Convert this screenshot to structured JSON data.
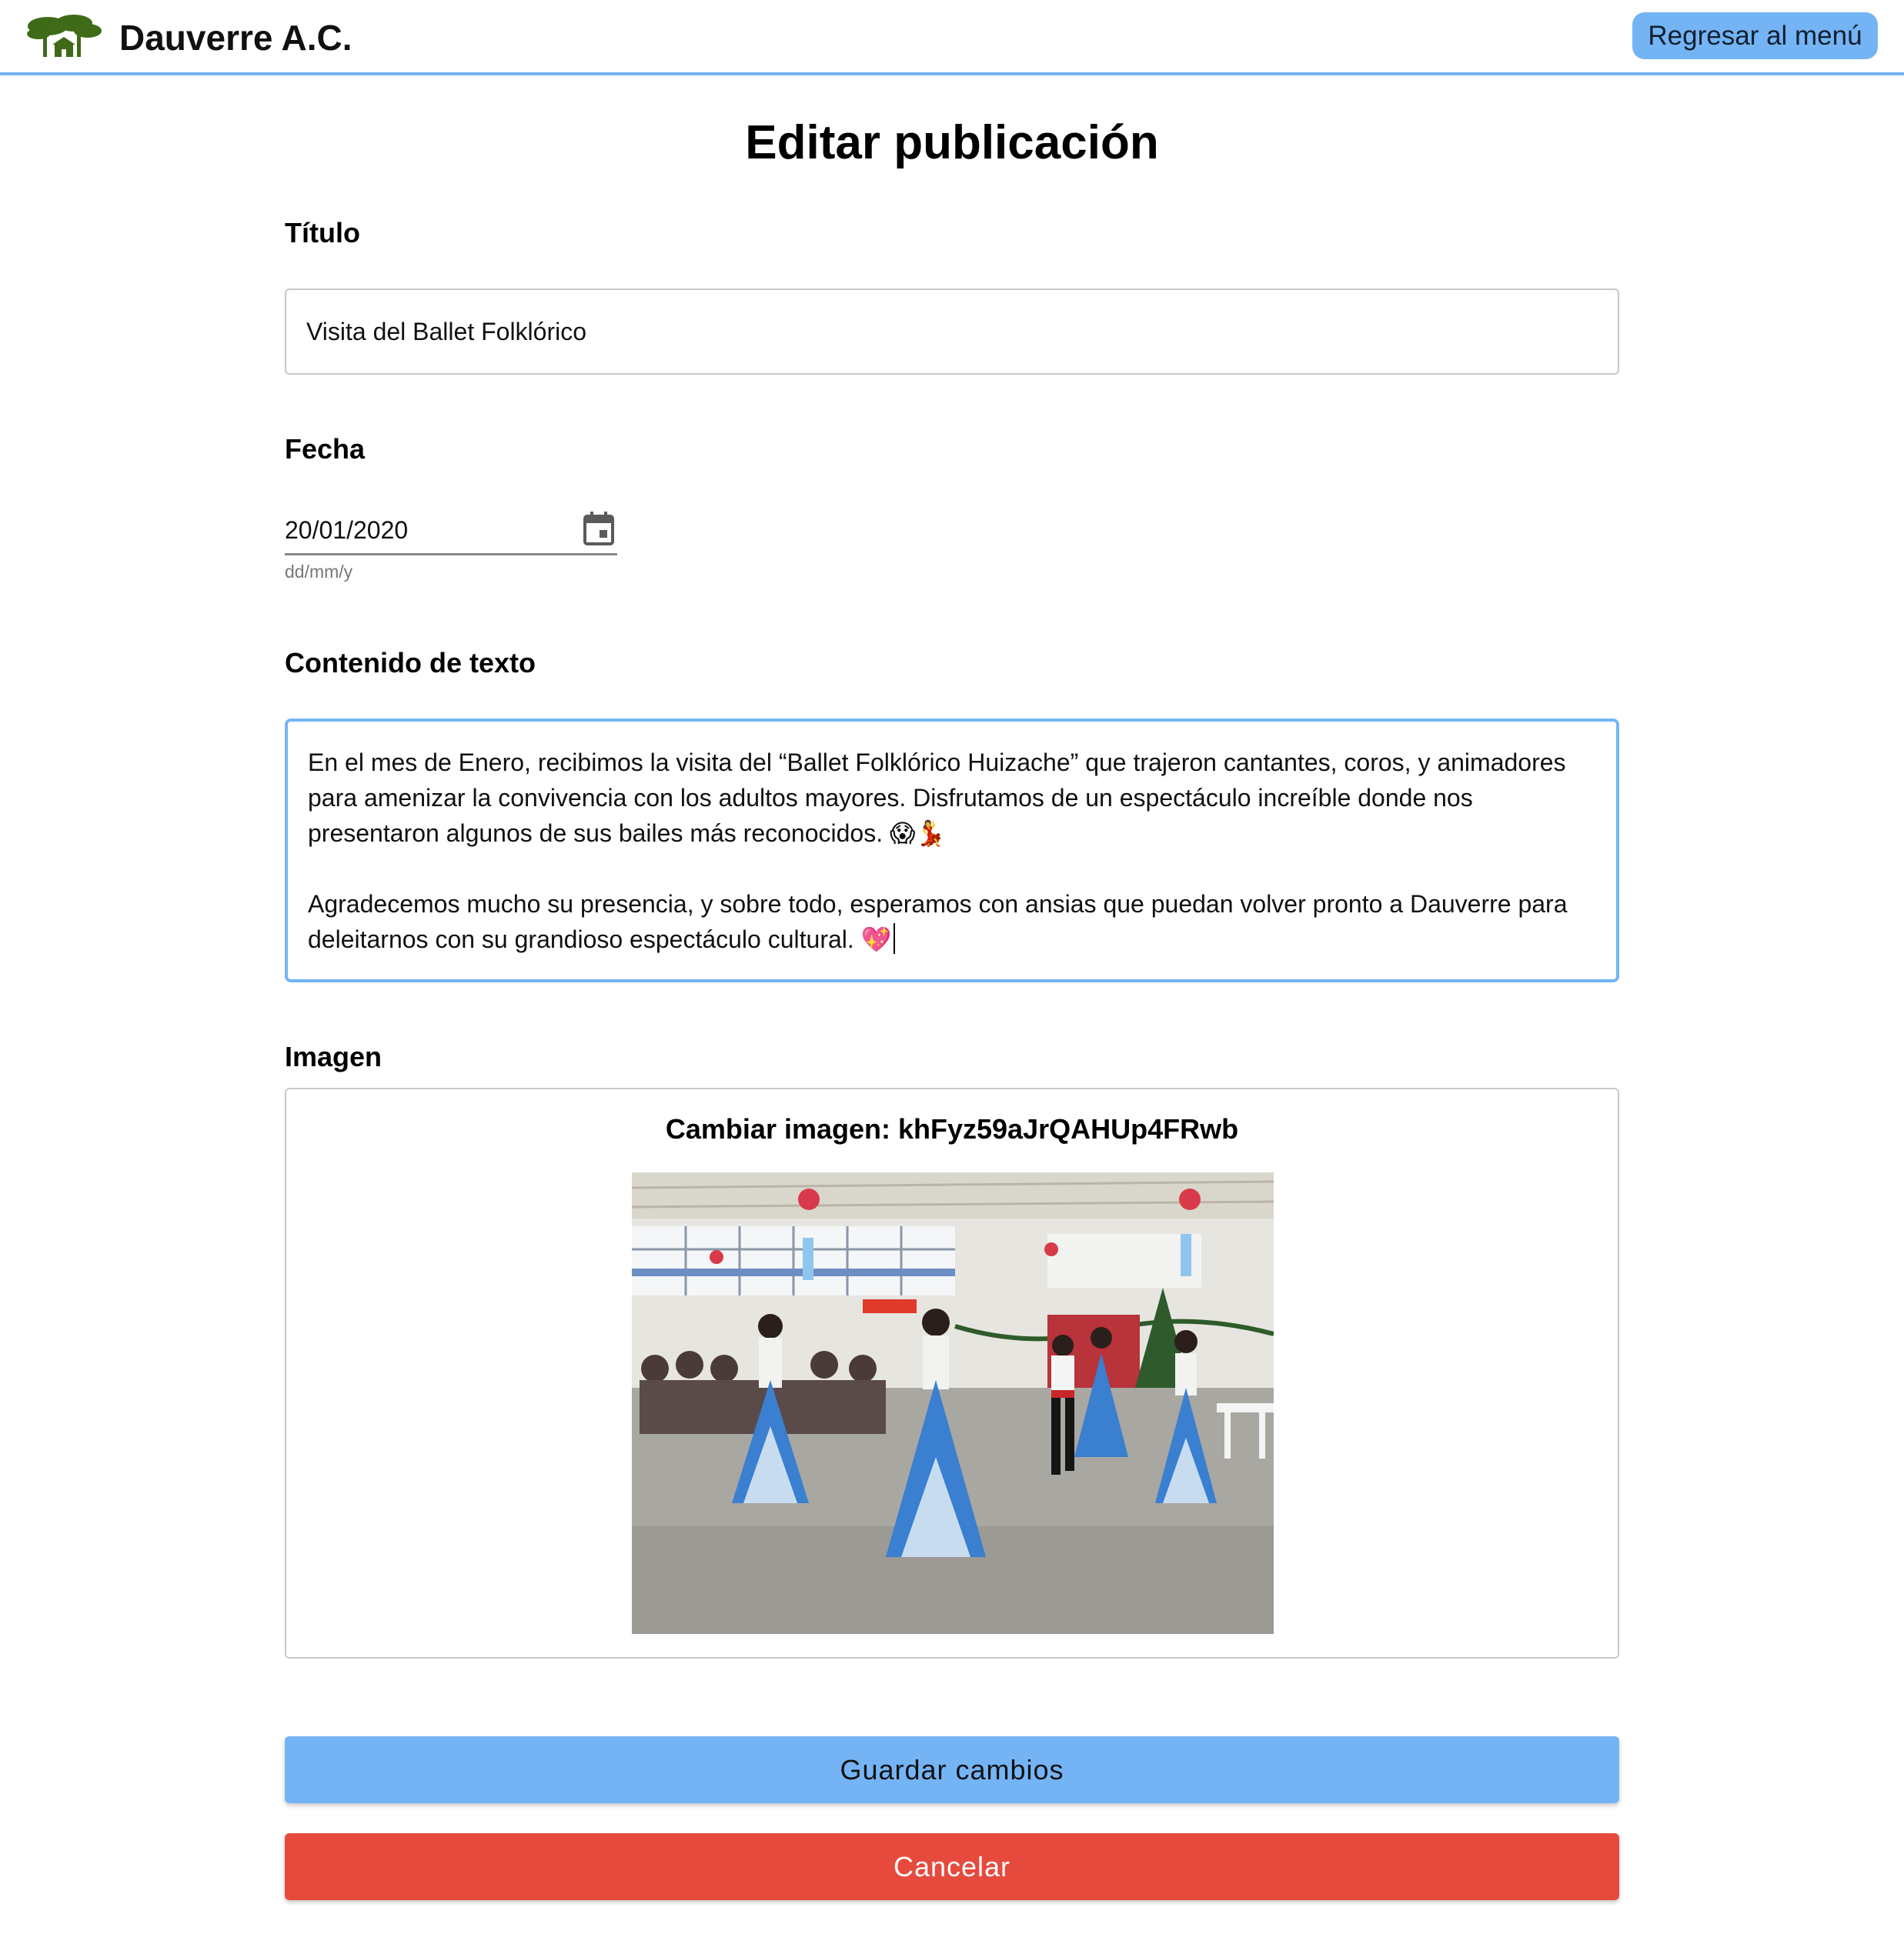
{
  "header": {
    "brand": "Dauverre A.C.",
    "logo_icon": "tree-logo-icon",
    "back_button_label": "Regresar al menú"
  },
  "page": {
    "title": "Editar publicación"
  },
  "form": {
    "title_label": "Título",
    "title_value": "Visita del Ballet Folklórico",
    "date_label": "Fecha",
    "date_value": "20/01/2020",
    "date_hint": "dd/mm/y",
    "date_icon": "calendar-icon",
    "content_label": "Contenido de texto",
    "content_paragraph_1": "En el mes de Enero, recibimos la visita del “Ballet Folklórico Huizache” que trajeron cantantes, coros, y animadores para amenizar la convivencia con los adultos mayores. Disfrutamos de un espectáculo increíble donde nos presentaron algunos de sus bailes más reconocidos. 😱💃",
    "content_paragraph_2": "Agradecemos mucho su presencia, y sobre todo, esperamos con ansias que puedan volver pronto a Dauverre para deleitarnos con su grandioso espectáculo cultural. 💖",
    "image_label": "Imagen",
    "image_caption": "Cambiar imagen: khFyz59aJrQAHUp4FRwb"
  },
  "actions": {
    "save_label": "Guardar cambios",
    "cancel_label": "Cancelar"
  },
  "colors": {
    "accent": "#74b4f5",
    "danger": "#e64a3d",
    "logo_green": "#3f6a18"
  }
}
